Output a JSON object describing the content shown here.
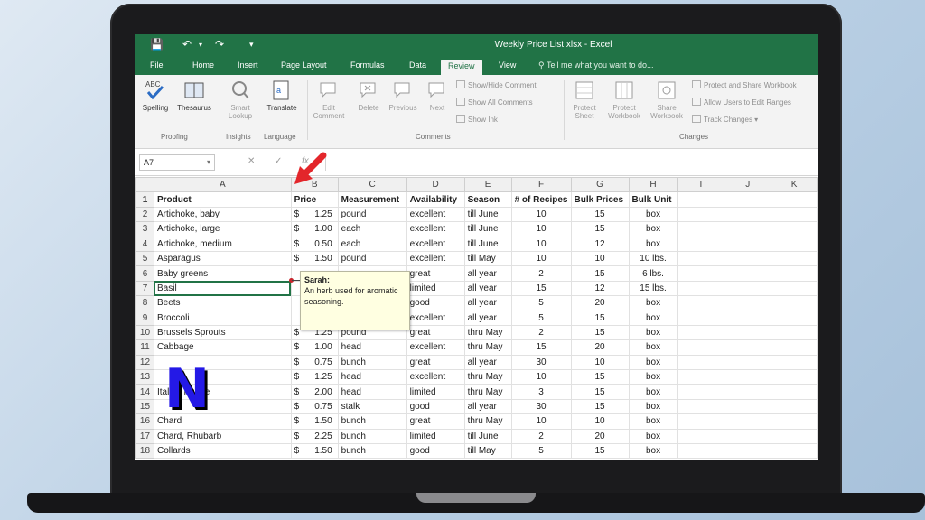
{
  "window": {
    "title": "Weekly Price List.xlsx - Excel"
  },
  "tabs": [
    "File",
    "Home",
    "Insert",
    "Page Layout",
    "Formulas",
    "Data",
    "Review",
    "View"
  ],
  "active_tab": "Review",
  "tell_me": "Tell me what you want to do...",
  "ribbon": {
    "spelling": "Spelling",
    "thesaurus": "Thesaurus",
    "smart_lookup": "Smart Lookup",
    "translate": "Translate",
    "edit_comment": "Edit Comment",
    "delete": "Delete",
    "previous": "Previous",
    "next": "Next",
    "show_hide_comment": "Show/Hide Comment",
    "show_all_comments": "Show All Comments",
    "show_ink": "Show Ink",
    "protect_sheet": "Protect Sheet",
    "protect_workbook": "Protect Workbook",
    "share_workbook": "Share Workbook",
    "protect_and_share": "Protect and Share Workbook",
    "allow_users": "Allow Users to Edit Ranges",
    "track_changes": "Track Changes",
    "groups": {
      "proofing": "Proofing",
      "insights": "Insights",
      "language": "Language",
      "comments": "Comments",
      "changes": "Changes"
    }
  },
  "name_box": "A7",
  "formula_buttons": {
    "cancel": "✕",
    "enter": "✓",
    "fx": "fx"
  },
  "columns": [
    "A",
    "B",
    "C",
    "D",
    "E",
    "F",
    "G",
    "H",
    "I",
    "J",
    "K"
  ],
  "header_row": [
    "Product",
    "Price",
    "Measurement",
    "Availability",
    "Season",
    "# of Recipes",
    "Bulk Prices",
    "Bulk Unit"
  ],
  "rows": [
    [
      "Artichoke, baby",
      "1.25",
      "pound",
      "excellent",
      "till June",
      "10",
      "15",
      "box"
    ],
    [
      "Artichoke, large",
      "1.00",
      "each",
      "excellent",
      "till June",
      "10",
      "15",
      "box"
    ],
    [
      "Artichoke, medium",
      "0.50",
      "each",
      "excellent",
      "till June",
      "10",
      "12",
      "box"
    ],
    [
      "Asparagus",
      "1.50",
      "pound",
      "excellent",
      "till May",
      "10",
      "10",
      "10 lbs."
    ],
    [
      "Baby greens",
      "",
      "",
      "great",
      "all year",
      "2",
      "15",
      "6 lbs."
    ],
    [
      "Basil",
      "",
      "",
      "limited",
      "all year",
      "15",
      "12",
      "15 lbs."
    ],
    [
      "Beets",
      "",
      "",
      "good",
      "all year",
      "5",
      "20",
      "box"
    ],
    [
      "Broccoli",
      "",
      "",
      "excellent",
      "all year",
      "5",
      "15",
      "box"
    ],
    [
      "Brussels Sprouts",
      "1.25",
      "pound",
      "great",
      "thru May",
      "2",
      "15",
      "box"
    ],
    [
      "Cabbage",
      "1.00",
      "head",
      "excellent",
      "thru May",
      "15",
      "20",
      "box"
    ],
    [
      "",
      "0.75",
      "bunch",
      "great",
      "all year",
      "30",
      "10",
      "box"
    ],
    [
      "",
      "1.25",
      "head",
      "excellent",
      "thru May",
      "10",
      "15",
      "box"
    ],
    [
      "Italian Purple",
      "2.00",
      "head",
      "limited",
      "thru May",
      "3",
      "15",
      "box"
    ],
    [
      "",
      "0.75",
      "stalk",
      "good",
      "all year",
      "30",
      "15",
      "box"
    ],
    [
      "Chard",
      "1.50",
      "bunch",
      "great",
      "thru May",
      "10",
      "10",
      "box"
    ],
    [
      "Chard, Rhubarb",
      "2.25",
      "bunch",
      "limited",
      "till June",
      "2",
      "20",
      "box"
    ],
    [
      "Collards",
      "1.50",
      "bunch",
      "good",
      "till May",
      "5",
      "15",
      "box"
    ]
  ],
  "currency_symbol": "$",
  "comment": {
    "author": "Sarah:",
    "text": "An herb used for aromatic seasoning."
  },
  "overlay_logo": "N",
  "colors": {
    "excel_green": "#217346",
    "excellent_text": "#e0402f",
    "arrow": "#e3262b",
    "logo": "#2419e6"
  }
}
